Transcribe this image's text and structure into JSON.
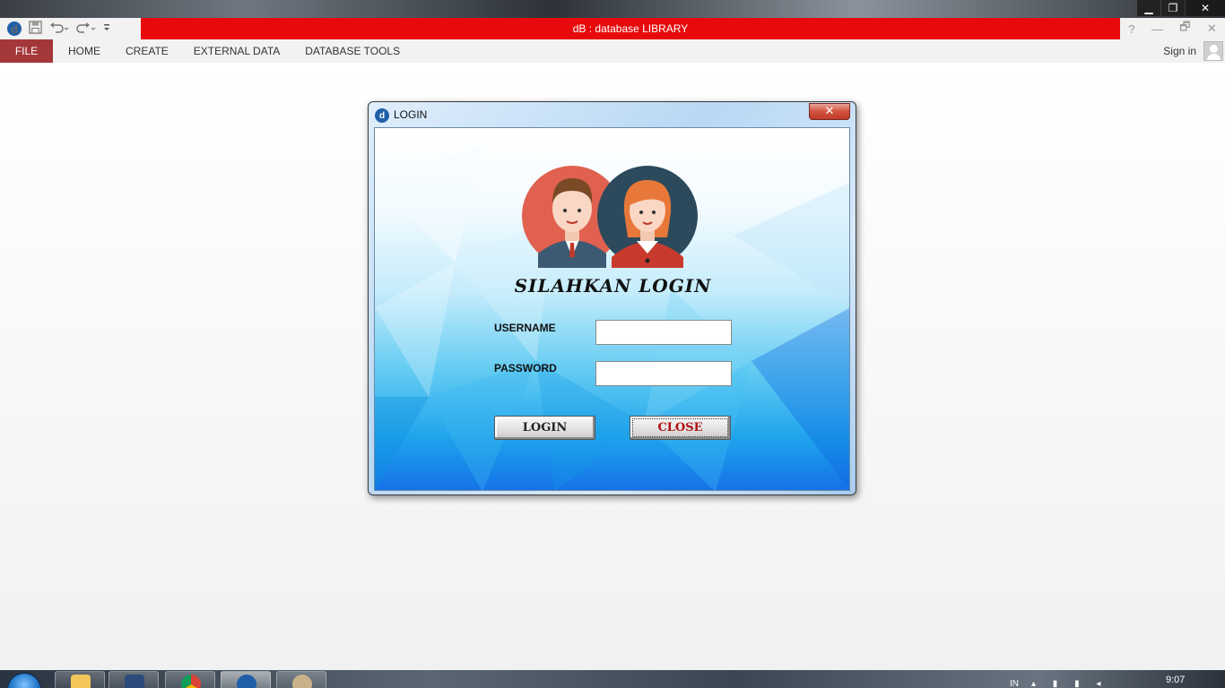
{
  "app": {
    "title": "dB : database LIBRARY",
    "logo_glyph": "d",
    "accent_color": "#e8090c",
    "file_tab_color": "#a4373a"
  },
  "quick_access": {
    "icons": [
      "app-logo-icon",
      "save-icon",
      "undo-icon",
      "redo-icon",
      "customize-icon"
    ]
  },
  "window_controls": {
    "help": "?",
    "minimize": "—",
    "restore": "🗗",
    "close": "✕"
  },
  "os_controls": {
    "minimize": "▁",
    "restore": "❐",
    "close": "✕"
  },
  "ribbon": {
    "tabs": [
      {
        "label": "FILE"
      },
      {
        "label": "HOME"
      },
      {
        "label": "CREATE"
      },
      {
        "label": "EXTERNAL DATA"
      },
      {
        "label": "DATABASE TOOLS"
      }
    ],
    "sign_in": "Sign in"
  },
  "login_dialog": {
    "title": "LOGIN",
    "close_glyph": "✕",
    "heading": "SILAHKAN LOGIN",
    "username_label": "USERNAME",
    "password_label": "PASSWORD",
    "username_value": "",
    "password_value": "",
    "login_button": "LOGIN",
    "close_button": "CLOSE",
    "close_button_color": "#b01010"
  },
  "taskbar": {
    "apps": [
      "start-orb",
      "folder-icon",
      "virtualbox-icon",
      "chrome-icon",
      "database-app-icon",
      "paint-icon"
    ],
    "language": "IN",
    "time": "9:07"
  }
}
